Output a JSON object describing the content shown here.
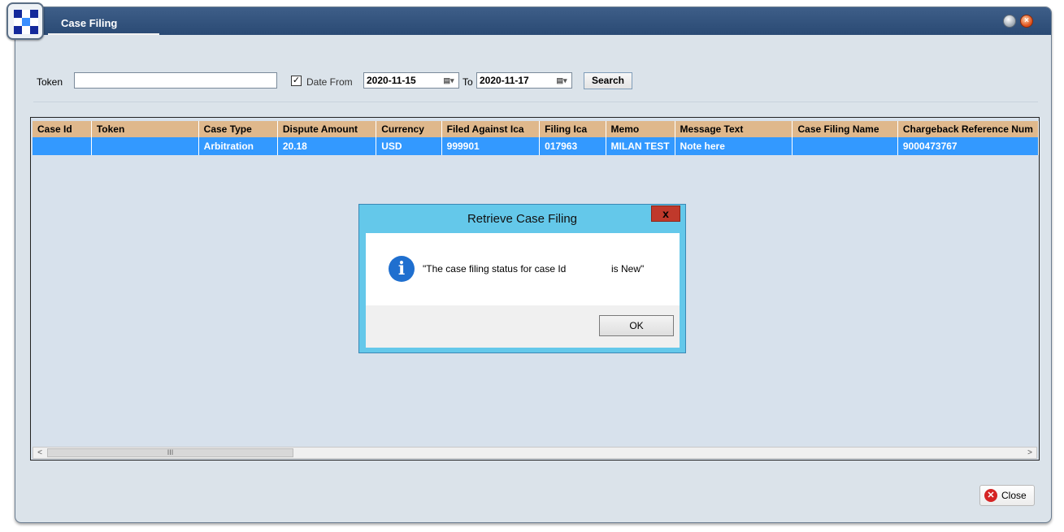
{
  "window": {
    "title": "Case Filing"
  },
  "filters": {
    "token_label": "Token",
    "token_value": "",
    "date_from_checked": true,
    "date_from_label": "Date From",
    "date_from": "2020-11-15",
    "to_label": "To",
    "date_to": "2020-11-17",
    "search_label": "Search"
  },
  "table": {
    "columns": [
      "Case Id",
      "Token",
      "Case Type",
      "Dispute Amount",
      "Currency",
      "Filed Against Ica",
      "Filing Ica",
      "Memo",
      "Message Text",
      "Case Filing Name",
      "Chargeback Reference Num"
    ],
    "rows": [
      [
        "",
        "",
        "Arbitration",
        "20.18",
        "USD",
        "999901",
        "017963",
        "MILAN TEST",
        "Note here",
        "",
        "9000473767"
      ]
    ]
  },
  "scrollbar": {
    "thumb_glyph": "III",
    "left_arrow": "<",
    "right_arrow": ">"
  },
  "footer": {
    "close_label": "Close"
  },
  "dialog": {
    "title": "Retrieve Case Filing",
    "close_glyph": "x",
    "message_part1": "\"The case filing status for case Id",
    "message_part2": "is New\"",
    "ok_label": "OK"
  },
  "colors": {
    "titlebar": "#2f4f79",
    "grid_header": "#dfb88c",
    "selected_row": "#3399ff",
    "dialog_frame": "#64c8ea",
    "dialog_close": "#c0392b"
  }
}
